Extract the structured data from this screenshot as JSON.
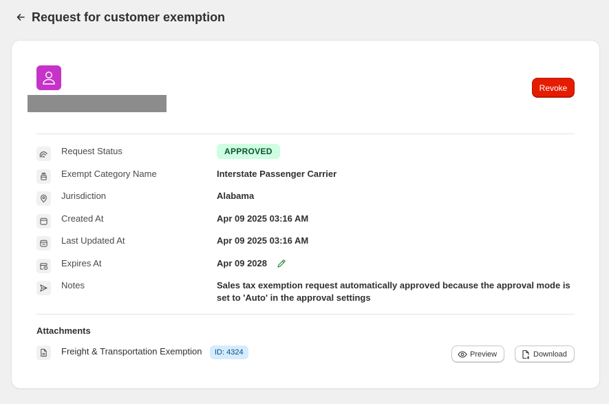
{
  "header": {
    "title": "Request for customer exemption"
  },
  "actions": {
    "revoke_label": "Revoke"
  },
  "details": [
    {
      "icon": "status-icon",
      "label": "Request Status",
      "value": "APPROVED"
    },
    {
      "icon": "category-icon",
      "label": "Exempt Category Name",
      "value": "Interstate Passenger Carrier"
    },
    {
      "icon": "location-icon",
      "label": "Jurisdiction",
      "value": "Alabama"
    },
    {
      "icon": "calendar-icon",
      "label": "Created At",
      "value": "Apr 09 2025 03:16 AM"
    },
    {
      "icon": "calendar-updated-icon",
      "label": "Last Updated At",
      "value": "Apr 09 2025 03:16 AM"
    },
    {
      "icon": "calendar-expiry-icon",
      "label": "Expires At",
      "value": "Apr 09 2028"
    },
    {
      "icon": "send-icon",
      "label": "Notes",
      "value": "Sales tax exemption request automatically approved because the approval mode is set to 'Auto' in the approval settings"
    }
  ],
  "attachments": {
    "title": "Attachments",
    "items": [
      {
        "name": "Freight & Transportation Exemption",
        "id_badge": "ID: 4324"
      }
    ],
    "preview_label": "Preview",
    "download_label": "Download"
  },
  "colors": {
    "avatar": "#c633c8",
    "revoke": "#e51c00",
    "approved_badge_bg": "#cdfee1",
    "approved_badge_text": "#0c5132",
    "id_badge_bg": "#d7ebff"
  }
}
